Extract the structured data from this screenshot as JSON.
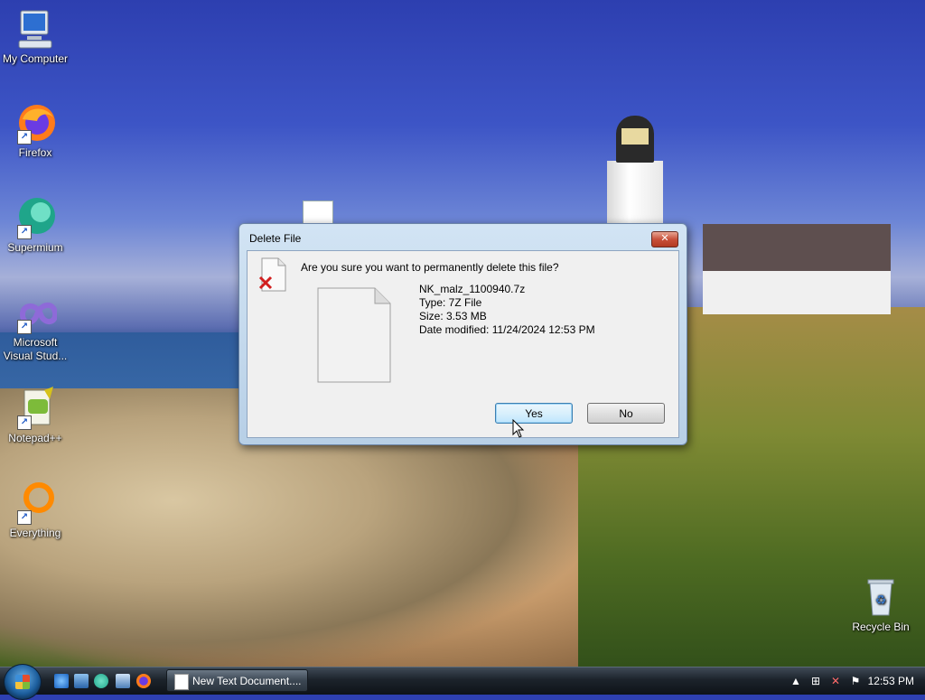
{
  "desktop": {
    "icons": [
      {
        "label": "My Computer"
      },
      {
        "label": "Firefox"
      },
      {
        "label": "Supermium"
      },
      {
        "label": "Microsoft Visual Stud..."
      },
      {
        "label": "Notepad++"
      },
      {
        "label": "Everything"
      },
      {
        "label": "Recycle Bin"
      }
    ]
  },
  "dialog": {
    "title": "Delete File",
    "close_label": "✕",
    "question": "Are you sure you want to permanently delete this file?",
    "file": {
      "name": "NK_malz_1100940.7z",
      "type": "Type: 7Z File",
      "size": "Size: 3.53 MB",
      "modified": "Date modified: 11/24/2024 12:53 PM"
    },
    "yes_label": "Yes",
    "no_label": "No"
  },
  "taskbar": {
    "task_button_label": "New Text Document....",
    "clock": "12:53 PM",
    "quicklaunch": [
      "internet-explorer-icon",
      "show-desktop-icon",
      "supermium-icon",
      "switch-windows-icon",
      "firefox-icon"
    ]
  },
  "colors": {
    "taskbar": "#1c232b",
    "dialog_frame": "#b7cfe6",
    "yes_button": "#bee6fd"
  }
}
